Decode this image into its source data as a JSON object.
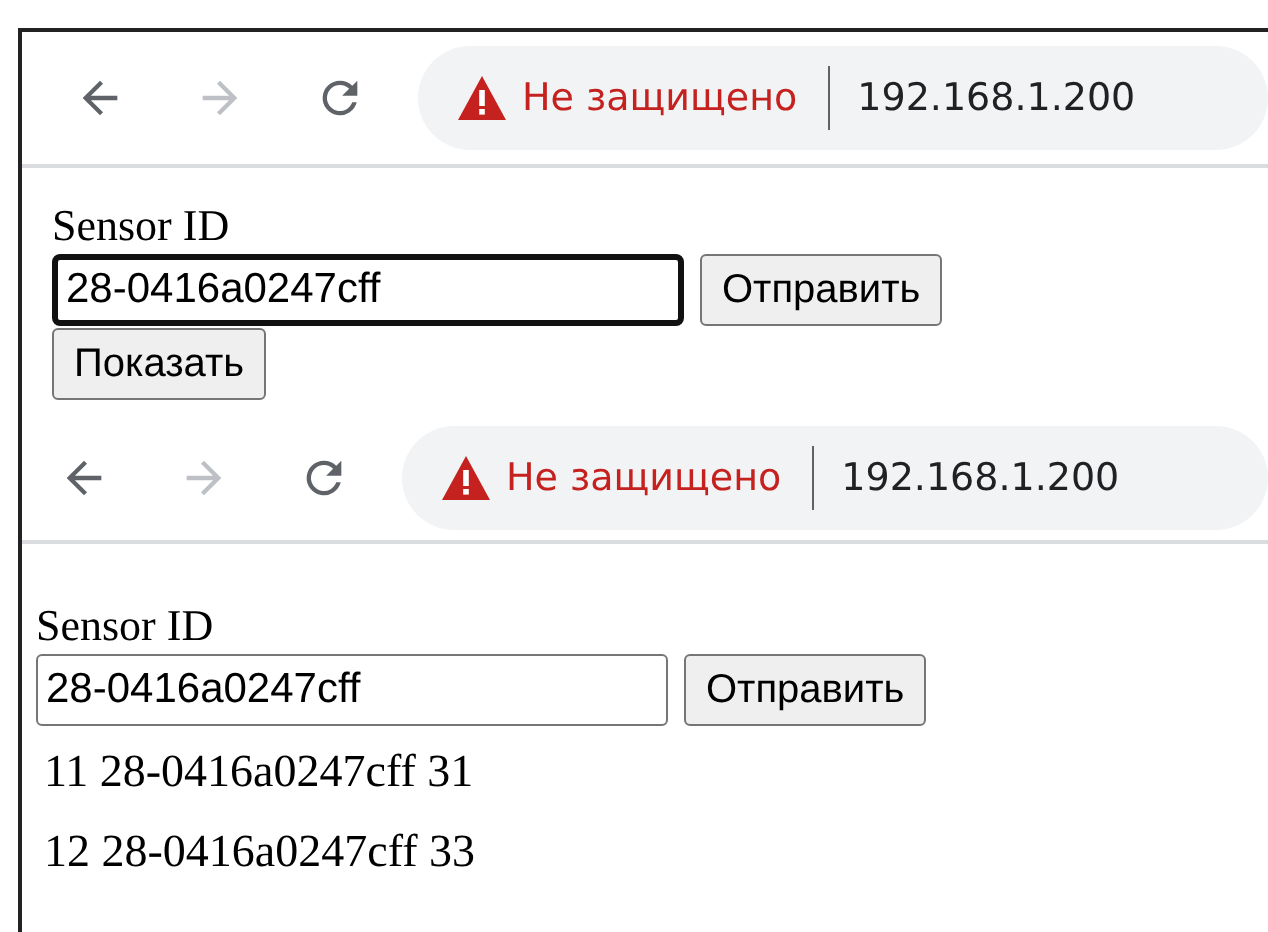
{
  "panels": [
    {
      "toolbar": {
        "can_go_forward": false,
        "security": "Не защищено",
        "url": "192.168.1.200"
      },
      "label": "Sensor ID",
      "input": {
        "value": "28-0416a0247cff",
        "focused": true
      },
      "buttons": [
        "Отправить",
        "Показать"
      ]
    },
    {
      "toolbar": {
        "can_go_forward": false,
        "security": "Не защищено",
        "url": "192.168.1.200"
      },
      "label": "Sensor ID",
      "input": {
        "value": "28-0416a0247cff",
        "focused": false
      },
      "buttons": [
        "Отправить"
      ],
      "lines": [
        "11 28-0416a0247cff 31",
        "12 28-0416a0247cff 33"
      ]
    }
  ]
}
